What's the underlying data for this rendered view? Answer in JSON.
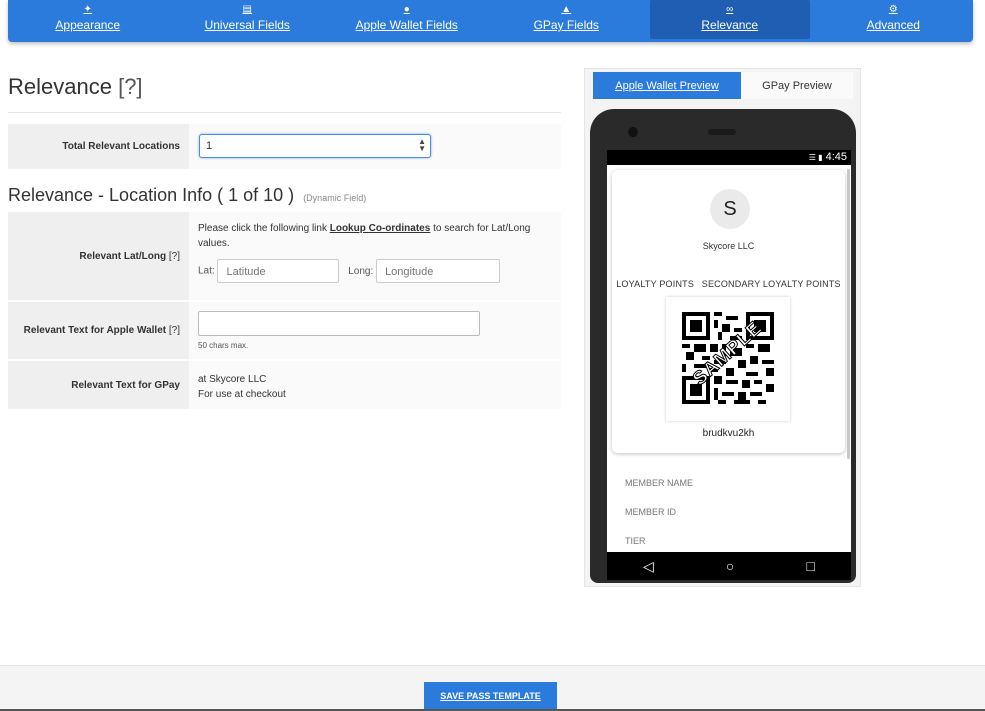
{
  "tabs": [
    {
      "label": "Appearance",
      "icon": "magic-wand-icon"
    },
    {
      "label": "Universal Fields",
      "icon": "document-icon"
    },
    {
      "label": "Apple Wallet Fields",
      "icon": "apple-icon"
    },
    {
      "label": "GPay Fields",
      "icon": "gpay-icon"
    },
    {
      "label": "Relevance",
      "icon": "link-icon",
      "active": true
    },
    {
      "label": "Advanced",
      "icon": "gears-icon"
    }
  ],
  "page": {
    "title": "Relevance",
    "help": "[?]"
  },
  "total_locations": {
    "label": "Total Relevant Locations",
    "value": "1"
  },
  "location_section": {
    "title": "Relevance - Location Info ( 1 of 10 )",
    "note": "(Dynamic Field)"
  },
  "latlong": {
    "label": "Relevant Lat/Long",
    "help": "[?]",
    "text_before": "Please click the following link ",
    "link": "Lookup Co-ordinates",
    "text_after": " to search for Lat/Long values.",
    "lat_label": "Lat:",
    "lat_placeholder": "Latitude",
    "long_label": "Long:",
    "long_placeholder": "Longitude"
  },
  "apple_text": {
    "label": "Relevant Text for Apple Wallet",
    "help": "[?]",
    "hint": "50 chars max."
  },
  "gpay_text": {
    "label": "Relevant Text for GPay",
    "line1": "at Skycore LLC",
    "line2": "For use at checkout"
  },
  "preview": {
    "apple_tab": "Apple Wallet Preview",
    "gpay_tab": "GPay Preview",
    "time": "4:45",
    "avatar_letter": "S",
    "company": "Skycore LLC",
    "points_label_1": "LOYALTY POINTS",
    "points_label_2": "SECONDARY LOYALTY POINTS",
    "watermark": "SAMPLE",
    "code": "brudkvu2kh",
    "fields": [
      "MEMBER NAME",
      "MEMBER ID",
      "TIER"
    ]
  },
  "footer": {
    "save_label": "SAVE PASS TEMPLATE"
  }
}
